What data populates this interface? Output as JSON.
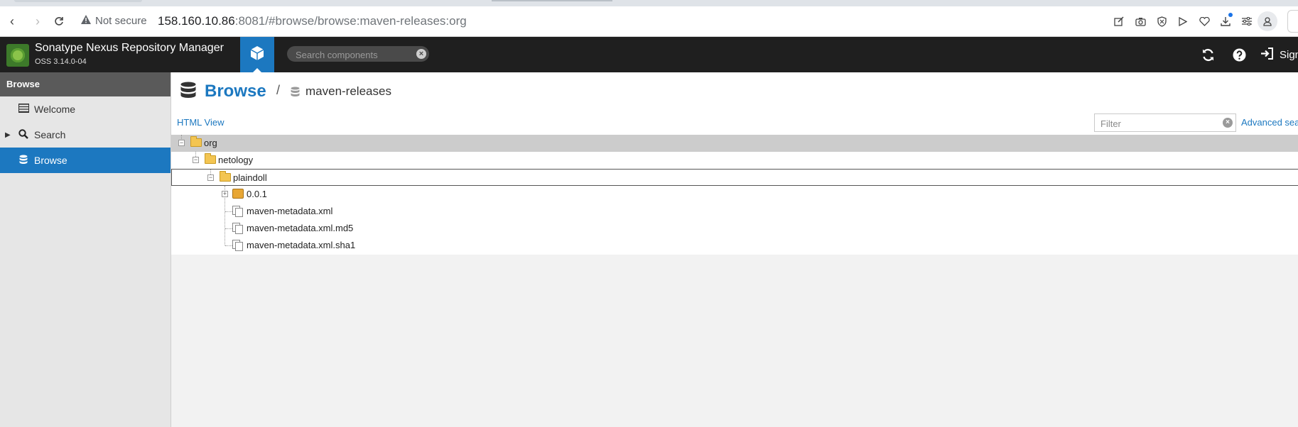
{
  "browser": {
    "security_label": "Not secure",
    "url_host": "158.160.10.86",
    "url_rest": ":8081/#browse/browse:maven-releases:org"
  },
  "app": {
    "title": "Sonatype Nexus Repository Manager",
    "version": "OSS 3.14.0-04",
    "search_placeholder": "Search components",
    "sign_in_label": "Sign"
  },
  "sidebar": {
    "header": "Browse",
    "items": [
      {
        "label": "Welcome",
        "icon": "list-icon"
      },
      {
        "label": "Search",
        "icon": "search-icon"
      },
      {
        "label": "Browse",
        "icon": "database-icon",
        "active": true
      }
    ]
  },
  "main": {
    "breadcrumb_title": "Browse",
    "breadcrumb_separator": "/",
    "breadcrumb_repo": "maven-releases",
    "html_view_label": "HTML View",
    "filter_placeholder": "Filter",
    "advanced_search_label": "Advanced sea"
  },
  "tree": {
    "nodes": [
      {
        "label": "org",
        "type": "folder",
        "depth": 0,
        "expanded": true,
        "selected": true
      },
      {
        "label": "netology",
        "type": "folder",
        "depth": 1,
        "expanded": true
      },
      {
        "label": "plaindoll",
        "type": "folder",
        "depth": 2,
        "expanded": true,
        "focused": true
      },
      {
        "label": "0.0.1",
        "type": "package",
        "depth": 3,
        "expanded": false
      },
      {
        "label": "maven-metadata.xml",
        "type": "file",
        "depth": 3
      },
      {
        "label": "maven-metadata.xml.md5",
        "type": "file",
        "depth": 3
      },
      {
        "label": "maven-metadata.xml.sha1",
        "type": "file",
        "depth": 3
      }
    ]
  },
  "colors": {
    "accent": "#1c78c0",
    "header_bg": "#1f1f1f",
    "sidebar_bg": "#e6e6e6",
    "selected_row": "#cccccc"
  }
}
